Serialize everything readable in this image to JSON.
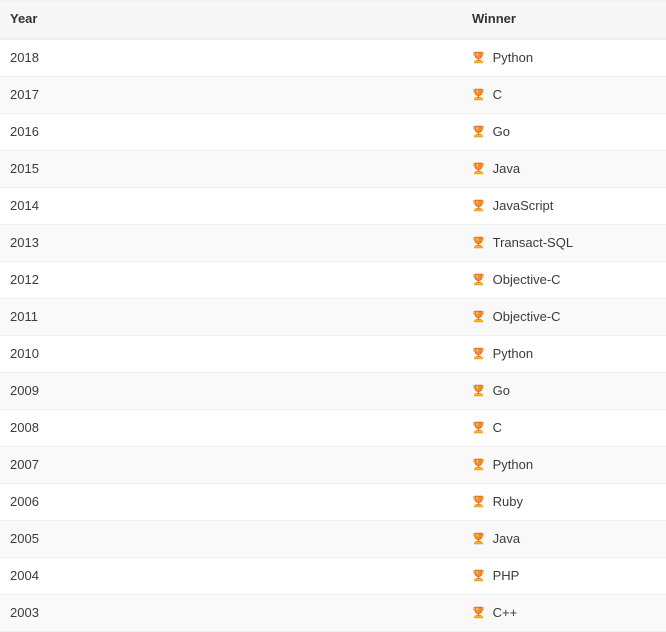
{
  "table": {
    "columns": [
      {
        "key": "year",
        "label": "Year"
      },
      {
        "key": "winner",
        "label": "Winner"
      }
    ],
    "icon": "trophy-icon",
    "icon_colors": {
      "cup": "#E8661E",
      "base": "#F5B731",
      "highlight": "#F9D26B"
    },
    "row_colors": {
      "odd": "#ffffff",
      "even": "#f9f9f9",
      "header": "#f7f7f7",
      "border": "#ededed",
      "header_border": "#eeeeee",
      "text": "#3b3b3b",
      "header_text": "#333333"
    },
    "rows": [
      {
        "year": "2018",
        "winner": "Python"
      },
      {
        "year": "2017",
        "winner": "C"
      },
      {
        "year": "2016",
        "winner": "Go"
      },
      {
        "year": "2015",
        "winner": "Java"
      },
      {
        "year": "2014",
        "winner": "JavaScript"
      },
      {
        "year": "2013",
        "winner": "Transact-SQL"
      },
      {
        "year": "2012",
        "winner": "Objective-C"
      },
      {
        "year": "2011",
        "winner": "Objective-C"
      },
      {
        "year": "2010",
        "winner": "Python"
      },
      {
        "year": "2009",
        "winner": "Go"
      },
      {
        "year": "2008",
        "winner": "C"
      },
      {
        "year": "2007",
        "winner": "Python"
      },
      {
        "year": "2006",
        "winner": "Ruby"
      },
      {
        "year": "2005",
        "winner": "Java"
      },
      {
        "year": "2004",
        "winner": "PHP"
      },
      {
        "year": "2003",
        "winner": "C++"
      }
    ]
  }
}
